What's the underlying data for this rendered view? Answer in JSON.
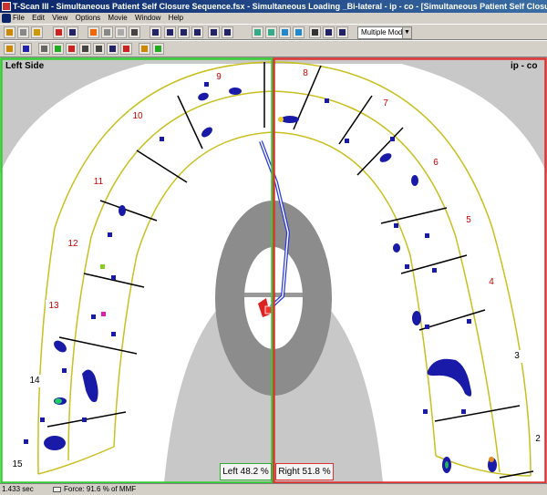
{
  "window": {
    "title": "T-Scan III - Simultaneous Patient Self Closure Sequence.fsx - Simultaneous Loading _Bi-lateral - ip - co - [Simultaneous Patient Self Closure Sequence.fsx - S]"
  },
  "menu": [
    "File",
    "Edit",
    "View",
    "Options",
    "Movie",
    "Window",
    "Help"
  ],
  "toolbar": {
    "mode_select": "Multiple Mode"
  },
  "view": {
    "left_label": "Left Side",
    "right_label": "ip - co",
    "left_percent": "Left 48.2 %",
    "right_percent": "Right 51.8 %",
    "tooth_numbers": [
      "2",
      "3",
      "4",
      "5",
      "6",
      "7",
      "8",
      "9",
      "10",
      "11",
      "12",
      "13",
      "14",
      "15"
    ],
    "colors": {
      "left_border": "#33cc33",
      "right_border": "#dd3333",
      "arch_outline": "#c8c020",
      "force_contact": "#1a1aa8",
      "tooth_label": "#cc0000"
    }
  },
  "status": {
    "time": "1.433 sec",
    "force": "Force: 91.6 % of MMF"
  }
}
